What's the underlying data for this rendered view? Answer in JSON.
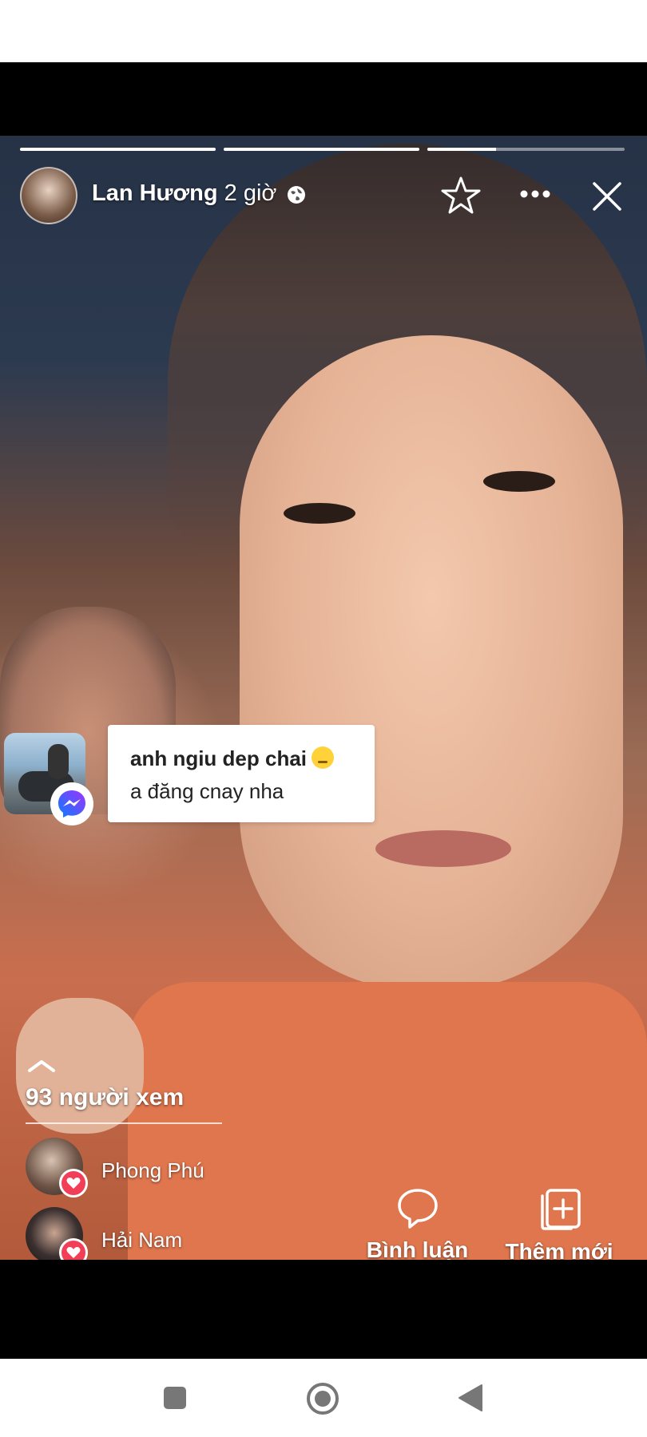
{
  "story": {
    "user_name": "Lan Hương",
    "time_ago": "2 giờ",
    "progress_segments": [
      1,
      1,
      0.35
    ],
    "icons": {
      "privacy": "globe-icon",
      "favorite": "star-icon",
      "more": "more-horizontal-icon",
      "close": "close-icon"
    }
  },
  "reply": {
    "line1": "anh ngiu dep chai",
    "line2": "a đăng cnay nha",
    "badge_icon": "messenger-icon"
  },
  "viewers": {
    "count_label": "93 người xem",
    "items": [
      {
        "name": "Phong Phú",
        "reaction": "heart-icon"
      },
      {
        "name": "Hải Nam",
        "reaction": "heart-icon"
      }
    ]
  },
  "actions": {
    "comment_label": "Bình luận",
    "add_new_label": "Thêm mới"
  },
  "colors": {
    "reaction": "#f33e58",
    "messenger_blue": "#0a7cff",
    "messenger_purple": "#a033ff"
  }
}
